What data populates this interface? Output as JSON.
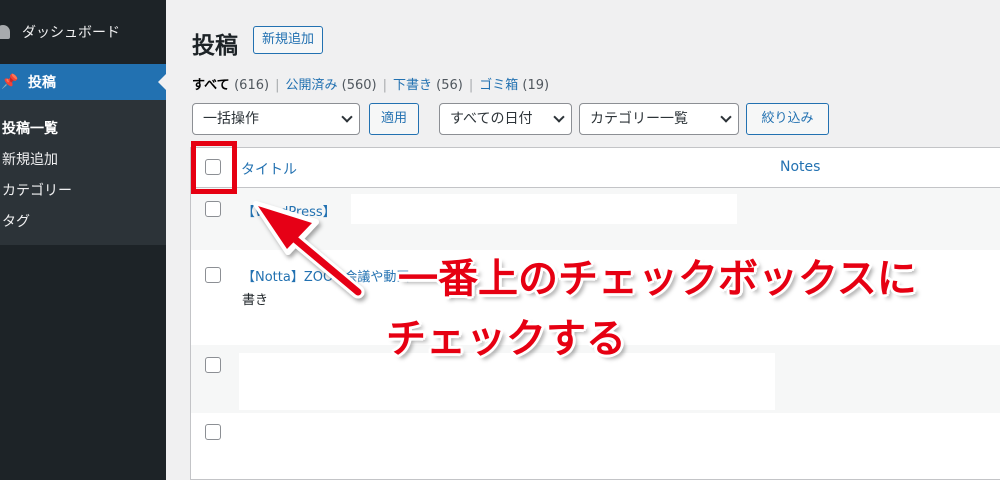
{
  "sidebar": {
    "dashboard_label": "ダッシュボード",
    "posts_label": "投稿",
    "submenu": [
      "投稿一覧",
      "新規追加",
      "カテゴリー",
      "タグ"
    ]
  },
  "header": {
    "title": "投稿",
    "add_new_label": "新規追加"
  },
  "filters": {
    "all_label": "すべて",
    "all_count": "(616)",
    "published_label": "公開済み",
    "published_count": "(560)",
    "draft_label": "下書き",
    "draft_count": "(56)",
    "trash_label": "ゴミ箱",
    "trash_count": "(19)",
    "sep": "|"
  },
  "toolbar": {
    "bulk_action": "一括操作",
    "apply_label": "適用",
    "date_filter": "すべての日付",
    "category_filter": "カテゴリー一覧",
    "filter_label": "絞り込み"
  },
  "table": {
    "columns": {
      "title": "タイトル",
      "notes": "Notes"
    },
    "rows": [
      {
        "title": "【WordPress】"
      },
      {
        "title": "【Notta】ZOOM会議や動画",
        "extra": "書き"
      },
      {
        "title": ""
      },
      {
        "title": ""
      }
    ]
  },
  "annotation": {
    "line1": "一番上のチェックボックスに",
    "line2": "チェックする",
    "color": "#e60012"
  },
  "colors": {
    "accent": "#2271b1",
    "sidebar": "#1d2327"
  }
}
